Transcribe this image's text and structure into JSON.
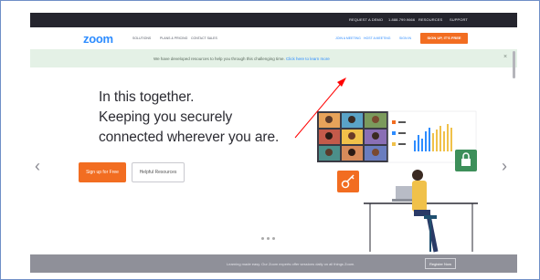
{
  "topbar": {
    "links": [
      "REQUEST A DEMO",
      "1.888.799.9666",
      "RESOURCES",
      "SUPPORT"
    ]
  },
  "navbar": {
    "logo": "zoom",
    "left_items": [
      "SOLUTIONS",
      "PLANS & PRICING",
      "CONTACT SALES"
    ],
    "right_items": [
      "JOIN A MEETING",
      "HOST A MEETING",
      "SIGN IN"
    ],
    "signup_button": "SIGN UP, IT'S FREE"
  },
  "banner": {
    "text": "We have developed resources to help you through this challenging time.",
    "link": "Click here to learn more",
    "close": "×"
  },
  "hero": {
    "line1": "In this together.",
    "line2": "Keeping you securely",
    "line3": "connected wherever you are.",
    "primary_button": "Sign up for Free",
    "secondary_button": "Helpful Resources"
  },
  "carousel": {
    "prev": "‹",
    "next": "›"
  },
  "footer": {
    "text": "Learning made easy. Our Zoom experts offer sessions daily on all things Zoom.",
    "button": "Register Now"
  },
  "colors": {
    "brand_blue": "#2d8cff",
    "accent_orange": "#f26d21",
    "banner_green": "#e4f1e6",
    "annotation_red": "#ff0000"
  }
}
